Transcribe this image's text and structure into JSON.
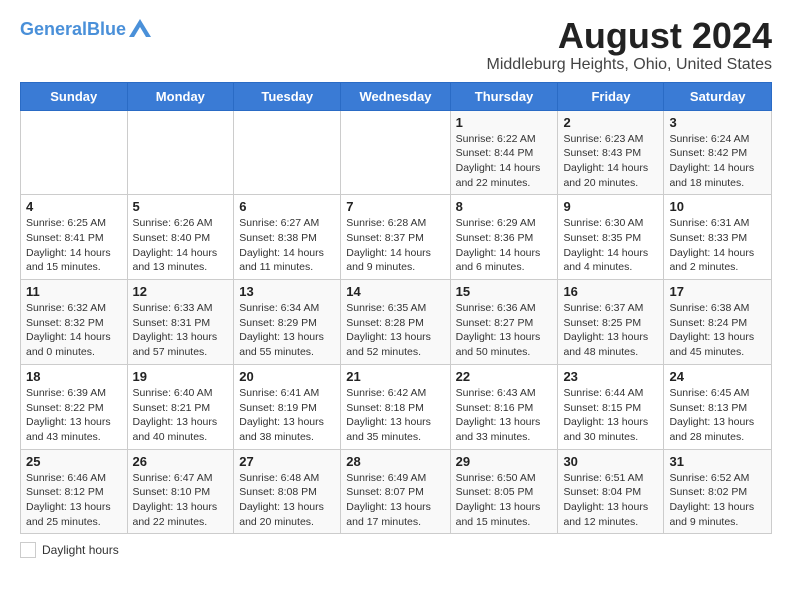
{
  "header": {
    "logo_general": "General",
    "logo_blue": "Blue",
    "title": "August 2024",
    "subtitle": "Middleburg Heights, Ohio, United States"
  },
  "footer": {
    "daylight_label": "Daylight hours"
  },
  "weekdays": [
    "Sunday",
    "Monday",
    "Tuesday",
    "Wednesday",
    "Thursday",
    "Friday",
    "Saturday"
  ],
  "weeks": [
    [
      {
        "date": "",
        "info": ""
      },
      {
        "date": "",
        "info": ""
      },
      {
        "date": "",
        "info": ""
      },
      {
        "date": "",
        "info": ""
      },
      {
        "date": "1",
        "info": "Sunrise: 6:22 AM\nSunset: 8:44 PM\nDaylight: 14 hours\nand 22 minutes."
      },
      {
        "date": "2",
        "info": "Sunrise: 6:23 AM\nSunset: 8:43 PM\nDaylight: 14 hours\nand 20 minutes."
      },
      {
        "date": "3",
        "info": "Sunrise: 6:24 AM\nSunset: 8:42 PM\nDaylight: 14 hours\nand 18 minutes."
      }
    ],
    [
      {
        "date": "4",
        "info": "Sunrise: 6:25 AM\nSunset: 8:41 PM\nDaylight: 14 hours\nand 15 minutes."
      },
      {
        "date": "5",
        "info": "Sunrise: 6:26 AM\nSunset: 8:40 PM\nDaylight: 14 hours\nand 13 minutes."
      },
      {
        "date": "6",
        "info": "Sunrise: 6:27 AM\nSunset: 8:38 PM\nDaylight: 14 hours\nand 11 minutes."
      },
      {
        "date": "7",
        "info": "Sunrise: 6:28 AM\nSunset: 8:37 PM\nDaylight: 14 hours\nand 9 minutes."
      },
      {
        "date": "8",
        "info": "Sunrise: 6:29 AM\nSunset: 8:36 PM\nDaylight: 14 hours\nand 6 minutes."
      },
      {
        "date": "9",
        "info": "Sunrise: 6:30 AM\nSunset: 8:35 PM\nDaylight: 14 hours\nand 4 minutes."
      },
      {
        "date": "10",
        "info": "Sunrise: 6:31 AM\nSunset: 8:33 PM\nDaylight: 14 hours\nand 2 minutes."
      }
    ],
    [
      {
        "date": "11",
        "info": "Sunrise: 6:32 AM\nSunset: 8:32 PM\nDaylight: 14 hours\nand 0 minutes."
      },
      {
        "date": "12",
        "info": "Sunrise: 6:33 AM\nSunset: 8:31 PM\nDaylight: 13 hours\nand 57 minutes."
      },
      {
        "date": "13",
        "info": "Sunrise: 6:34 AM\nSunset: 8:29 PM\nDaylight: 13 hours\nand 55 minutes."
      },
      {
        "date": "14",
        "info": "Sunrise: 6:35 AM\nSunset: 8:28 PM\nDaylight: 13 hours\nand 52 minutes."
      },
      {
        "date": "15",
        "info": "Sunrise: 6:36 AM\nSunset: 8:27 PM\nDaylight: 13 hours\nand 50 minutes."
      },
      {
        "date": "16",
        "info": "Sunrise: 6:37 AM\nSunset: 8:25 PM\nDaylight: 13 hours\nand 48 minutes."
      },
      {
        "date": "17",
        "info": "Sunrise: 6:38 AM\nSunset: 8:24 PM\nDaylight: 13 hours\nand 45 minutes."
      }
    ],
    [
      {
        "date": "18",
        "info": "Sunrise: 6:39 AM\nSunset: 8:22 PM\nDaylight: 13 hours\nand 43 minutes."
      },
      {
        "date": "19",
        "info": "Sunrise: 6:40 AM\nSunset: 8:21 PM\nDaylight: 13 hours\nand 40 minutes."
      },
      {
        "date": "20",
        "info": "Sunrise: 6:41 AM\nSunset: 8:19 PM\nDaylight: 13 hours\nand 38 minutes."
      },
      {
        "date": "21",
        "info": "Sunrise: 6:42 AM\nSunset: 8:18 PM\nDaylight: 13 hours\nand 35 minutes."
      },
      {
        "date": "22",
        "info": "Sunrise: 6:43 AM\nSunset: 8:16 PM\nDaylight: 13 hours\nand 33 minutes."
      },
      {
        "date": "23",
        "info": "Sunrise: 6:44 AM\nSunset: 8:15 PM\nDaylight: 13 hours\nand 30 minutes."
      },
      {
        "date": "24",
        "info": "Sunrise: 6:45 AM\nSunset: 8:13 PM\nDaylight: 13 hours\nand 28 minutes."
      }
    ],
    [
      {
        "date": "25",
        "info": "Sunrise: 6:46 AM\nSunset: 8:12 PM\nDaylight: 13 hours\nand 25 minutes."
      },
      {
        "date": "26",
        "info": "Sunrise: 6:47 AM\nSunset: 8:10 PM\nDaylight: 13 hours\nand 22 minutes."
      },
      {
        "date": "27",
        "info": "Sunrise: 6:48 AM\nSunset: 8:08 PM\nDaylight: 13 hours\nand 20 minutes."
      },
      {
        "date": "28",
        "info": "Sunrise: 6:49 AM\nSunset: 8:07 PM\nDaylight: 13 hours\nand 17 minutes."
      },
      {
        "date": "29",
        "info": "Sunrise: 6:50 AM\nSunset: 8:05 PM\nDaylight: 13 hours\nand 15 minutes."
      },
      {
        "date": "30",
        "info": "Sunrise: 6:51 AM\nSunset: 8:04 PM\nDaylight: 13 hours\nand 12 minutes."
      },
      {
        "date": "31",
        "info": "Sunrise: 6:52 AM\nSunset: 8:02 PM\nDaylight: 13 hours\nand 9 minutes."
      }
    ]
  ]
}
